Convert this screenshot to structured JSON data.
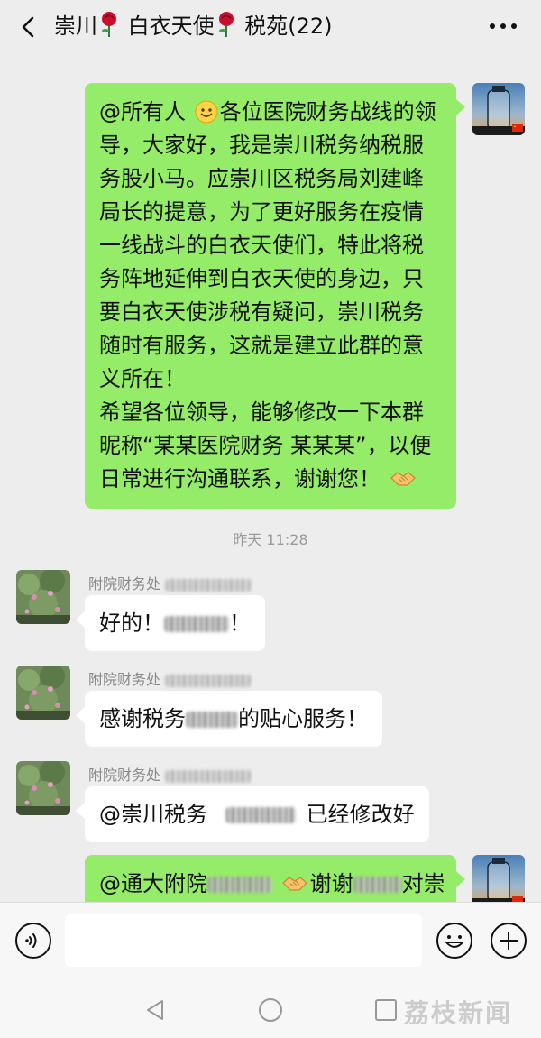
{
  "header": {
    "back_icon": "chevron-left-icon",
    "title_part1": "崇川",
    "title_part2": " 白衣天使",
    "title_part3": " 税苑(22)",
    "rose_icon": "rose-icon",
    "more_icon": "more-dots-icon"
  },
  "messages": [
    {
      "side": "right",
      "lines_a": "@所有人",
      "lines_b": "各位医院财务战线的领导，大家好，我是崇川税务纳税服务股小马。应崇川区税务局刘建峰局长的提意，为了更好服务在疫情一线战斗的白衣天使们，特此将税务阵地延伸到白衣天使的身边，只要白衣天使涉税有疑问，崇川税务随时有服务，这就是建立此群的意义所在！",
      "lines_c": "希望各位领导，能够修改一下本群昵称“某某医院财务 某某某”，以便日常进行沟通联系，谢谢您！",
      "smile_icon": "smile-emoji-icon",
      "handshake_icon": "handshake-emoji-icon"
    }
  ],
  "timestamp": "昨天 11:28",
  "msg2": {
    "sender": "附院财务处",
    "text_a": "好的！",
    "text_b": "！"
  },
  "msg3": {
    "sender": "附院财务处",
    "text_a": "感谢税务",
    "text_b": "的贴心服务！"
  },
  "msg4": {
    "sender": "附院财务处",
    "text_a": "@崇川税务",
    "text_b": "已经修改好"
  },
  "msg5": {
    "text_a": "@通大附院",
    "text_b": "谢谢",
    "text_c": "对崇"
  },
  "inputbar": {
    "voice_icon": "voice-icon",
    "emoji_icon": "emoji-icon",
    "plus_icon": "plus-icon"
  },
  "navbar": {
    "back_icon": "nav-back-icon",
    "home_icon": "nav-home-icon",
    "recent_icon": "nav-recent-icon",
    "watermark": "荔枝新闻"
  },
  "colors": {
    "bubble_green": "#95ec69",
    "background": "#ededed"
  }
}
